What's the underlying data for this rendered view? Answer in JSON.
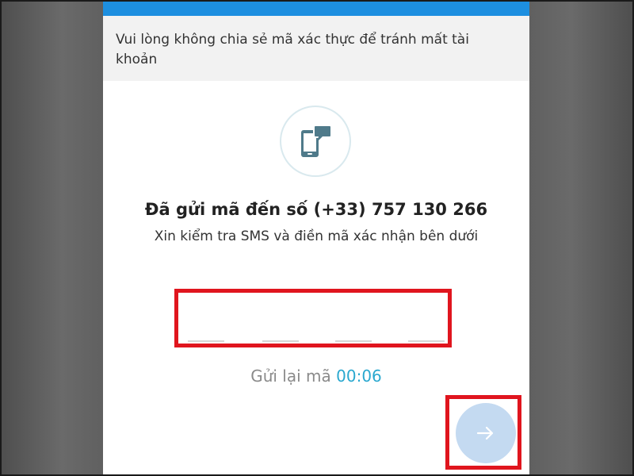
{
  "notice": {
    "text": "Vui lòng không chia sẻ mã xác thực để tránh mất tài khoản"
  },
  "verification": {
    "icon": "phone-message-icon",
    "heading": "Đã gửi mã đến số (+33) 757 130 266",
    "subtitle": "Xin kiểm tra SMS và điền mã xác nhận bên dưới"
  },
  "otp": {
    "digits": [
      "",
      "",
      "",
      ""
    ]
  },
  "resend": {
    "label": "Gửi lại mã",
    "timer": "00:06"
  },
  "next": {
    "icon": "arrow-right-icon"
  },
  "colors": {
    "topbar": "#1d8fe0",
    "highlight": "#e0151e",
    "timer": "#2aa8cf",
    "next_button": "#c4daf1"
  }
}
